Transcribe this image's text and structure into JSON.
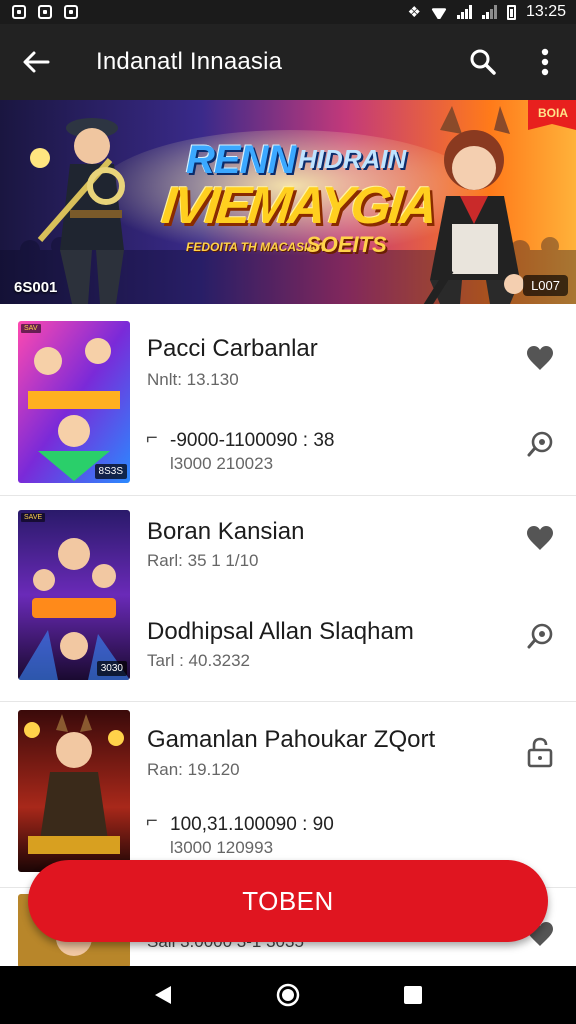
{
  "status_bar": {
    "time": "13:25",
    "icons": [
      "sim-icon",
      "photo-icon",
      "gallery-icon",
      "vibrate-icon",
      "wifi-icon",
      "signal-icon",
      "battery-icon"
    ]
  },
  "app_bar": {
    "title": "Indanatl Innaasia",
    "back_icon": "back-arrow-icon",
    "search_icon": "search-icon",
    "menu_icon": "more-vert-icon"
  },
  "banner": {
    "title_line1": "RENN",
    "title_line1b": "HIDRAIN",
    "title_line2": "IVIEMAYGIA",
    "title_line3": "FEDOITA TH MACASIAA",
    "title_line3b": "SOEITS",
    "tag": "BOIA",
    "count_left": "6S001",
    "count_right": "L007",
    "colors": {
      "sky": "#3a1d6e",
      "stage": "#ff8a1f"
    }
  },
  "items": [
    {
      "title": "Pacci Carbanlar",
      "subtitle": "Nnlt: 13.130",
      "code_main": "-9000-1100090 : 38",
      "code_sub": "l3000  210023",
      "thumb_badge": "8S3S",
      "thumb_corner": "SAV",
      "icon_top": "heart-icon",
      "icon_bottom": "chat-search-icon"
    },
    {
      "title": "Boran Kansian",
      "subtitle": "Rarl: 35 1 1/10",
      "title2": "Dodhipsal Allan Slaqham",
      "subtitle2": "Tarl : 40.3232",
      "thumb_badge": "3030",
      "thumb_corner": "SAVE",
      "icon_top": "heart-icon",
      "icon_bottom": "chat-search-icon"
    },
    {
      "title": "Gamanlan Pahoukar ZQort",
      "subtitle": "Ran: 19.120",
      "code_main": "100,31.100090 : 90",
      "code_sub": "l3000  120993",
      "icon_top": "lock-icon"
    },
    {
      "partial": "Sall 3.0000 3-1 3035",
      "icon_top": "heart-icon"
    }
  ],
  "main_button": {
    "label": "TOBEN"
  },
  "nav_bar": {
    "icons": [
      "back-triangle-icon",
      "home-circle-icon",
      "recents-square-icon"
    ]
  },
  "accent_color": "#e01520"
}
